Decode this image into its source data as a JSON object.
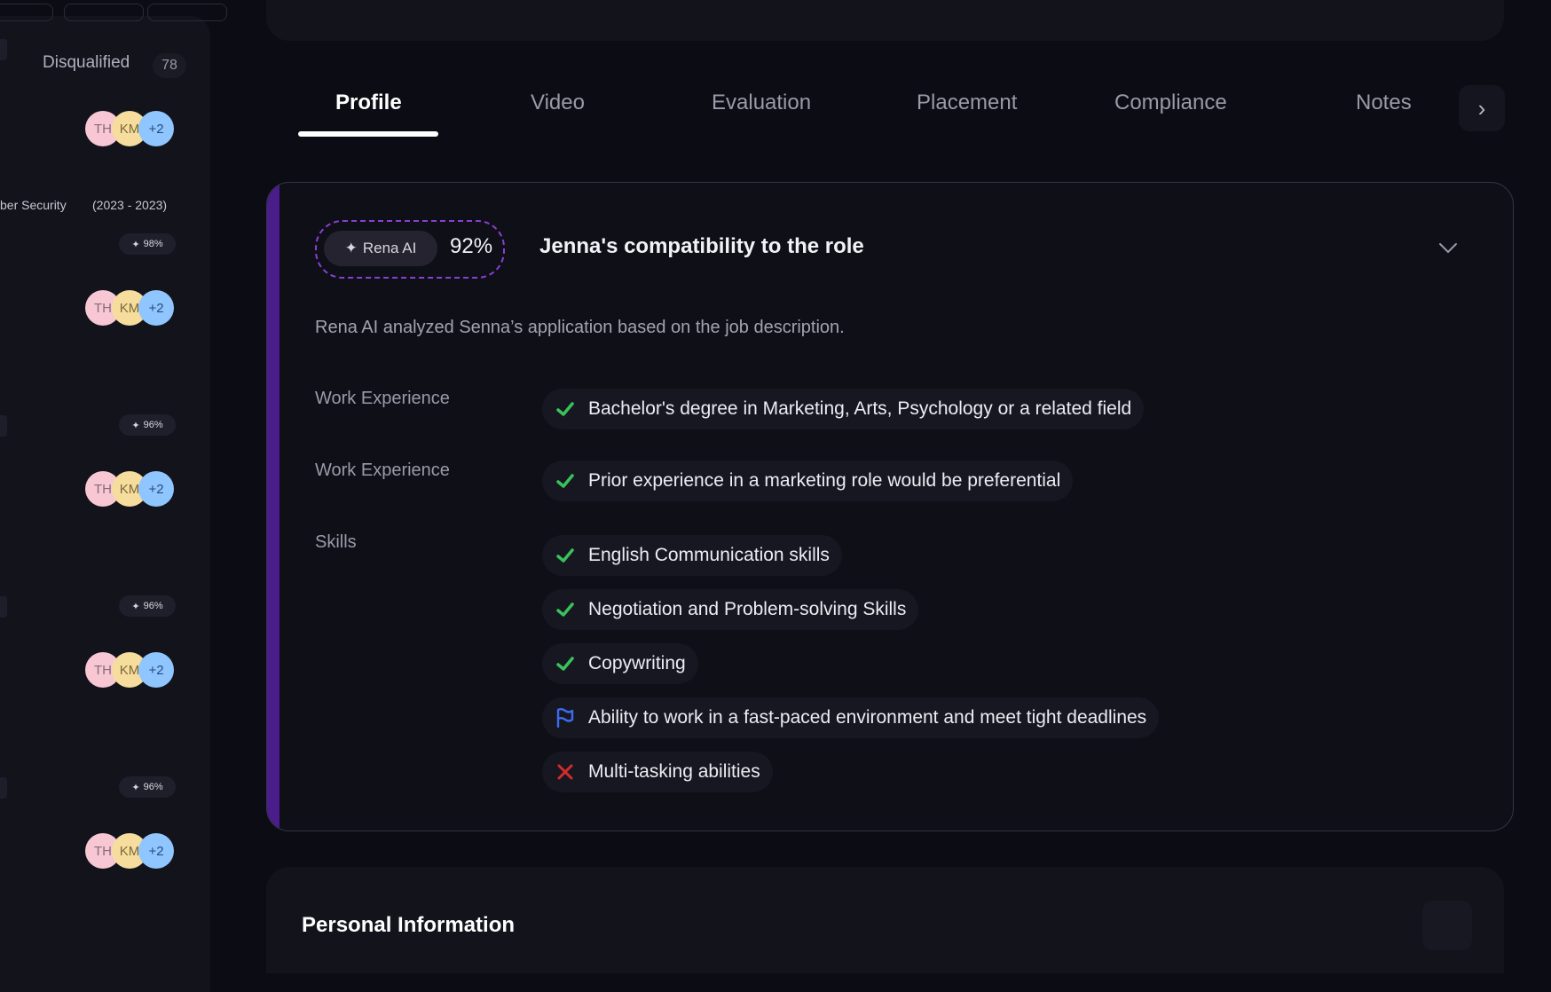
{
  "sidebar": {
    "disqualified_label": "Disqualified",
    "disqualified_count": "78",
    "course_text": "ber Security",
    "course_years": "(2023 - 2023)",
    "avatar_initials": [
      "TH",
      "KM",
      "+2"
    ],
    "ai_scores": [
      "98%",
      "96%",
      "96%",
      "96%"
    ]
  },
  "tabs": [
    {
      "label": "Profile",
      "active": true
    },
    {
      "label": "Video",
      "active": false
    },
    {
      "label": "Evaluation",
      "active": false
    },
    {
      "label": "Placement",
      "active": false
    },
    {
      "label": "Compliance",
      "active": false
    },
    {
      "label": "Notes",
      "active": false
    }
  ],
  "compat": {
    "ai_label": "Rena AI",
    "score": "92%",
    "title": "Jenna's compatibility to the role",
    "description": "Rena AI analyzed  Senna’s application based on the job description.",
    "sections": [
      {
        "label": "Work Experience",
        "items": [
          {
            "status": "met",
            "text": "Bachelor's degree in Marketing, Arts, Psychology or a related field"
          }
        ]
      },
      {
        "label": "Work Experience",
        "items": [
          {
            "status": "met",
            "text": "Prior experience in a marketing role would be preferential"
          }
        ]
      },
      {
        "label": "Skills",
        "items": [
          {
            "status": "met",
            "text": "English Communication skills"
          },
          {
            "status": "met",
            "text": "Negotiation and Problem-solving Skills"
          },
          {
            "status": "met",
            "text": "Copywriting"
          },
          {
            "status": "flagged",
            "text": "Ability to work in a fast-paced environment and meet tight deadlines"
          },
          {
            "status": "unmet",
            "text": "Multi-tasking abilities"
          }
        ]
      }
    ]
  },
  "personal": {
    "title": "Personal Information"
  },
  "colors": {
    "met": "#39c25a",
    "flagged": "#3b6cf0",
    "unmet": "#d42b2b",
    "accent": "#8a3fd4"
  }
}
